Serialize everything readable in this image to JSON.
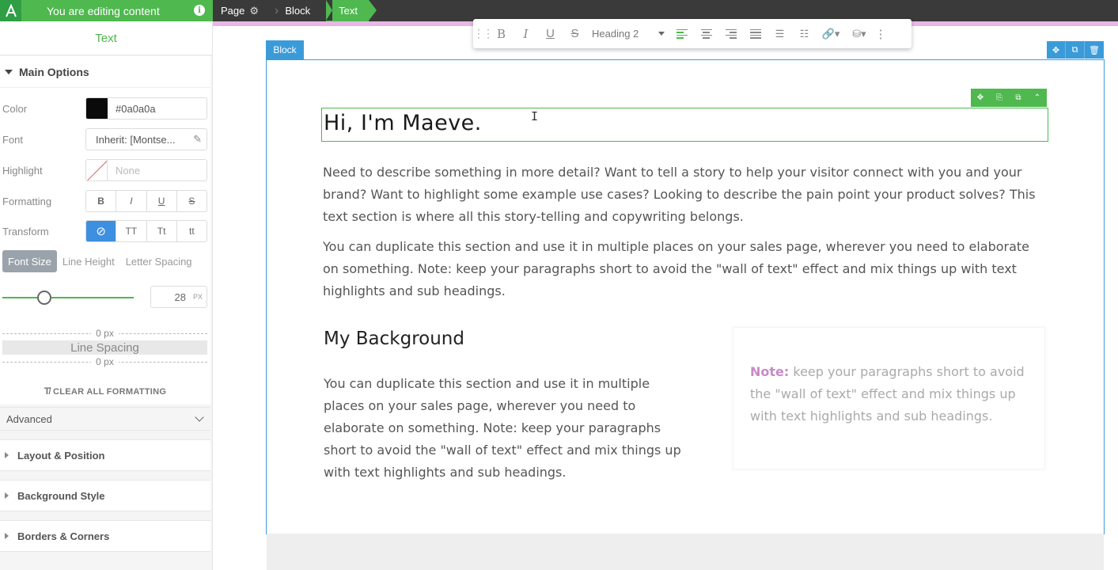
{
  "topbar": {
    "editing_label": "You are editing content",
    "breadcrumbs": [
      "Page",
      "Block",
      "Text"
    ]
  },
  "sidebar": {
    "title": "Text",
    "main_options_label": "Main Options",
    "color": {
      "label": "Color",
      "value": "#0a0a0a"
    },
    "font": {
      "label": "Font",
      "value": "Inherit: [Montse..."
    },
    "highlight": {
      "label": "Highlight",
      "value": "None"
    },
    "formatting": {
      "label": "Formatting",
      "buttons": [
        "B",
        "I",
        "U",
        "S"
      ]
    },
    "transform": {
      "label": "Transform",
      "buttons": [
        "⊘",
        "TT",
        "Tt",
        "tt"
      ]
    },
    "size_tabs": [
      "Font Size",
      "Line Height",
      "Letter Spacing"
    ],
    "font_size": {
      "value": "28",
      "unit": "PX",
      "slider_fraction": 0.3
    },
    "spacing": {
      "top": "0 px",
      "label": "Line Spacing",
      "bottom": "0 px"
    },
    "clear_all": "CLEAR ALL FORMATTING",
    "advanced": "Advanced",
    "sections": [
      "Layout & Position",
      "Background Style",
      "Borders & Corners"
    ]
  },
  "toolbar": {
    "heading_select": "Heading 2"
  },
  "canvas": {
    "block_tag": "Block",
    "heading": "Hi, I'm Maeve.",
    "paragraph1": "Need to describe something in more detail? Want to tell a story to help your visitor connect with you and your brand? Want to highlight some example use cases? Looking to describe the pain point your product solves? This text section is where all this story-telling and copywriting belongs.",
    "paragraph2": "You can duplicate this section and use it in multiple places on your sales page, wherever you need to elaborate on something. Note: keep your paragraphs short to avoid the \"wall of text\" effect and mix things up with text highlights and sub headings.",
    "subheading": "My Background",
    "paragraph3": "You can duplicate this section and use it in multiple places on your sales page, wherever you need to elaborate on something. Note: keep your paragraphs short to avoid the \"wall of text\" effect and mix things up with text highlights and sub headings.",
    "note_label": "Note:",
    "note_text": "keep your paragraphs short to avoid the \"wall of text\" effect and mix things up with text highlights and sub headings."
  },
  "colors": {
    "accent_green": "#4fb84f",
    "block_blue": "#3b9bd9",
    "note_pink": "#c88ac8"
  }
}
